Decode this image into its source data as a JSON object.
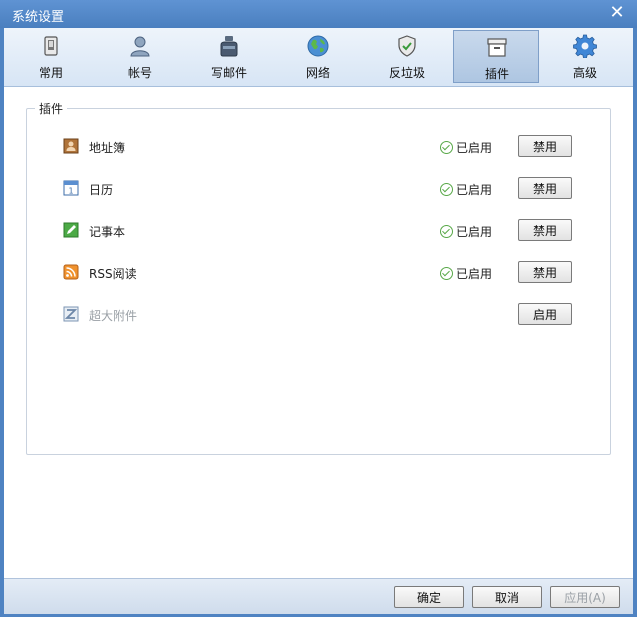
{
  "window": {
    "title": "系统设置"
  },
  "toolbar": {
    "tabs": [
      {
        "label": "常用",
        "icon": "phone-icon"
      },
      {
        "label": "帐号",
        "icon": "user-icon"
      },
      {
        "label": "写邮件",
        "icon": "inkwell-icon"
      },
      {
        "label": "网络",
        "icon": "globe-icon"
      },
      {
        "label": "反垃圾",
        "icon": "shield-icon"
      },
      {
        "label": "插件",
        "icon": "box-icon",
        "active": true
      },
      {
        "label": "高级",
        "icon": "gear-icon"
      }
    ]
  },
  "plugins": {
    "group_label": "插件",
    "enabled_text": "已启用",
    "items": [
      {
        "name": "地址簿",
        "status": "已启用",
        "button": "禁用",
        "icon": "address-book-icon"
      },
      {
        "name": "日历",
        "status": "已启用",
        "button": "禁用",
        "icon": "calendar-icon"
      },
      {
        "name": "记事本",
        "status": "已启用",
        "button": "禁用",
        "icon": "notepad-icon"
      },
      {
        "name": "RSS阅读",
        "status": "已启用",
        "button": "禁用",
        "icon": "rss-icon"
      },
      {
        "name": "超大附件",
        "status": "",
        "button": "启用",
        "icon": "attachment-icon"
      }
    ]
  },
  "footer": {
    "ok": "确定",
    "cancel": "取消",
    "apply": "应用(A)"
  },
  "colors": {
    "title_bar": "#4f83c2",
    "toolbar": "#dce8f6",
    "active_tab": "#b8cde6",
    "check": "#58a848"
  }
}
